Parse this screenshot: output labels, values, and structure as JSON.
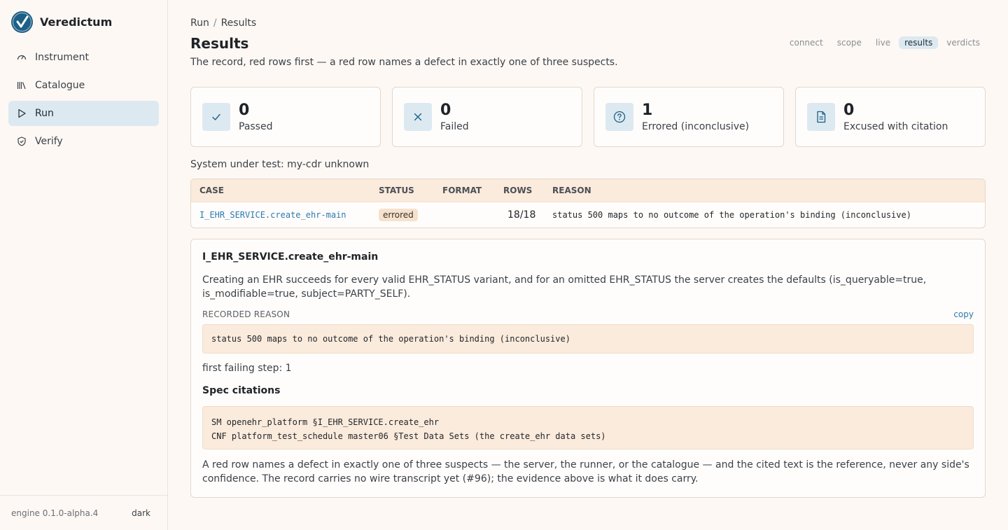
{
  "app": {
    "name": "Veredictum"
  },
  "sidebar": {
    "items": [
      {
        "label": "Instrument",
        "icon": "gauge-icon",
        "active": false
      },
      {
        "label": "Catalogue",
        "icon": "library-icon",
        "active": false
      },
      {
        "label": "Run",
        "icon": "play-icon",
        "active": true
      },
      {
        "label": "Verify",
        "icon": "shield-check-icon",
        "active": false
      }
    ],
    "engine_version": "engine 0.1.0-alpha.4",
    "theme_toggle": "dark"
  },
  "breadcrumb": {
    "parent": "Run",
    "sep": "/",
    "current": "Results"
  },
  "page": {
    "title": "Results",
    "subtitle": "The record, red rows first — a red row names a defect in exactly one of three suspects."
  },
  "steps": [
    {
      "label": "connect",
      "active": false
    },
    {
      "label": "scope",
      "active": false
    },
    {
      "label": "live",
      "active": false
    },
    {
      "label": "results",
      "active": true
    },
    {
      "label": "verdicts",
      "active": false
    }
  ],
  "stats": [
    {
      "value": "0",
      "label": "Passed",
      "icon": "check-icon"
    },
    {
      "value": "0",
      "label": "Failed",
      "icon": "x-icon"
    },
    {
      "value": "1",
      "label": "Errored (inconclusive)",
      "icon": "question-circle-icon"
    },
    {
      "value": "0",
      "label": "Excused with citation",
      "icon": "document-icon"
    }
  ],
  "system_under_test": "System under test: my-cdr unknown",
  "table": {
    "headers": {
      "case": "CASE",
      "status": "STATUS",
      "format": "FORMAT",
      "rows": "ROWS",
      "reason": "REASON"
    },
    "rows": [
      {
        "case": "I_EHR_SERVICE.create_ehr-main",
        "status": "errored",
        "format": "",
        "rows": "18/18",
        "reason": "status 500 maps to no outcome of the operation's binding (inconclusive)"
      }
    ]
  },
  "detail": {
    "title": "I_EHR_SERVICE.create_ehr-main",
    "description": "Creating an EHR succeeds for every valid EHR_STATUS variant, and for an omitted EHR_STATUS the server creates the defaults (is_queryable=true, is_modifiable=true, subject=PARTY_SELF).",
    "recorded_reason_label": "RECORDED REASON",
    "copy_label": "copy",
    "recorded_reason": "status 500 maps to no outcome of the operation's binding (inconclusive)",
    "first_failing_step": "first failing step: 1",
    "spec_citations_title": "Spec citations",
    "citations": [
      "SM openehr_platform §I_EHR_SERVICE.create_ehr",
      "CNF platform_test_schedule master06 §Test Data Sets (the create_ehr data sets)"
    ],
    "note": "A red row names a defect in exactly one of three suspects — the server, the runner, or the catalogue — and the cited text is the reference, never any side's confidence. The record carries no wire transcript yet (#96); the evidence above is what it does carry."
  },
  "colors": {
    "accent": "#1d5f86",
    "link": "#2a7ab0",
    "background": "#fdf8f4",
    "table_header": "#fbebdc",
    "badge": "#f6e2cc",
    "active_nav": "#dde9f1"
  }
}
